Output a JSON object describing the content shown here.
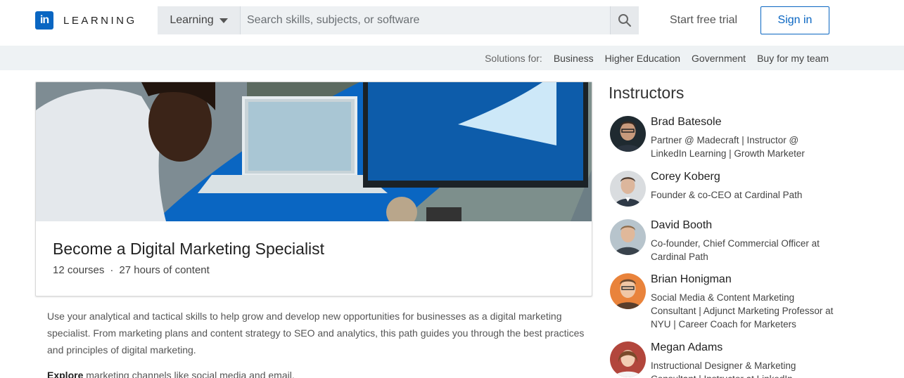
{
  "header": {
    "logo_mark": "in",
    "logo_text": "LEARNING",
    "search": {
      "dropdown_label": "Learning",
      "placeholder": "Search skills, subjects, or software",
      "value": ""
    },
    "start_trial": "Start free trial",
    "sign_in": "Sign in",
    "brand_color": "#0a66c2"
  },
  "subnav": {
    "label": "Solutions for:",
    "links": [
      "Business",
      "Higher Education",
      "Government",
      "Buy for my team"
    ]
  },
  "path": {
    "title": "Become a Digital Marketing Specialist",
    "courses": "12 courses",
    "separator": "·",
    "hours": "27 hours of content",
    "description": "Use your analytical and tactical skills to help grow and develop new opportunities for businesses as a digital marketing specialist. From marketing plans and content strategy to SEO and analytics, this path guides you through the best practices and principles of digital marketing.",
    "explore_bold": "Explore",
    "explore_rest": " marketing channels like social media and email."
  },
  "instructors": {
    "title": "Instructors",
    "items": [
      {
        "name": "Brad Batesole",
        "bio": "Partner @ Madecraft | Instructor @ LinkedIn Learning | Growth Marketer"
      },
      {
        "name": "Corey Koberg",
        "bio": "Founder & co-CEO at Cardinal Path"
      },
      {
        "name": "David Booth",
        "bio": "Co-founder, Chief Commercial Officer at Cardinal Path"
      },
      {
        "name": "Brian Honigman",
        "bio": "Social Media & Content Marketing Consultant | Adjunct Marketing Professor at NYU | Career Coach for Marketers"
      },
      {
        "name": "Megan Adams",
        "bio": "Instructional Designer & Marketing Consultant | Instructor at LinkedIn"
      }
    ]
  },
  "icons": {
    "search": "search-icon",
    "dropdown": "caret-down-icon"
  }
}
